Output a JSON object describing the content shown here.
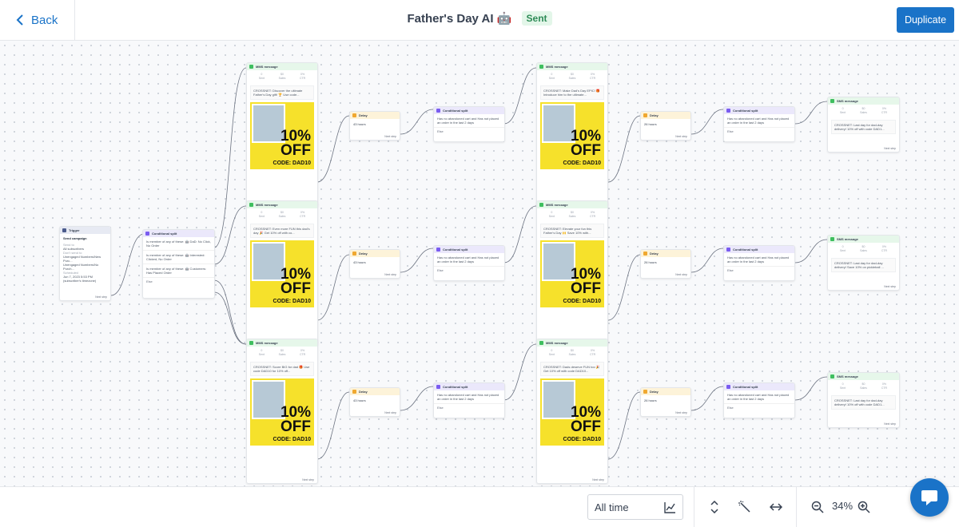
{
  "header": {
    "back_label": "Back",
    "title": "Father's Day AI 🤖",
    "status": "Sent",
    "duplicate_label": "Duplicate"
  },
  "trigger": {
    "header": "Trigger",
    "title": "Send campaign",
    "line1": "Send to",
    "line2": "All subscribers",
    "line3": "Don't send to",
    "line4": "Unengaged Numbers/New Purc...",
    "line5": "Unengaged Numbers/No Purch...",
    "line6": "Scheduled",
    "line7": "Jun 7, 2023 5:53 PM",
    "line8": "(subscriber's timezone)",
    "next": "Next step"
  },
  "first_split": {
    "header": "Conditional split",
    "opt1": "Is member of any of these: 🤖 DaD: No Click, No Order",
    "opt2": "Is member of any of these: 🤖 Interested: Clicked, No Order",
    "opt3": "Is member of any of these: 🤖 Customers: Has Placed Order",
    "else": "Else"
  },
  "labels": {
    "mms": "MMS message",
    "sms": "SMS message",
    "delay": "Delay",
    "split": "Conditional split",
    "next": "Next step",
    "else": "Else",
    "sent": "Sent",
    "sales": "Sales",
    "ctr": "CTR",
    "zero": "0",
    "zero_money": "$0",
    "zero_pct": "0%",
    "split_text": "Has no abandoned cart and Has not placed an order in the last 2 days",
    "offer": "10% OFF",
    "code": "CODE: DAD10"
  },
  "mms_texts": [
    "CROSSNET: Discover the ultimate Father's Day gift! 🏆 Use code...",
    "CROSSNET: Even more FUN this dad's day 🎉 Get 10% off with co...",
    "CROSSNET: Score BIG for dad 🎁 Use code DAD10 for 10% off...",
    "CROSSNET: Make Dad's Day EPIC! 🎁 Introduce him to the ultimate...",
    "CROSSNET: Elevate your fun this Father's Day 🙌 Save 10% with...",
    "CROSSNET: Dads deserve FUN too 🎉 Get 10% off with code DAD10..."
  ],
  "delays": [
    "43 hours",
    "43 hours",
    "43 hours",
    "26 hours",
    "26 hours",
    "26 hours"
  ],
  "sms_texts": [
    "CROSSNET: Last day for dad-day delivery! 10% off with code DAD1...",
    "CROSSNET: Last day for dad-day delivery! Save 10% on pickleball ...",
    "CROSSNET: Last day for dad-day delivery! 10% off with code DAD1..."
  ],
  "bottom": {
    "range": "All time",
    "zoom": "34%"
  },
  "colors": {
    "accent": "#1a73c8",
    "sent_badge_bg": "#e3f6e9",
    "promo_yellow": "#f6e12b"
  }
}
